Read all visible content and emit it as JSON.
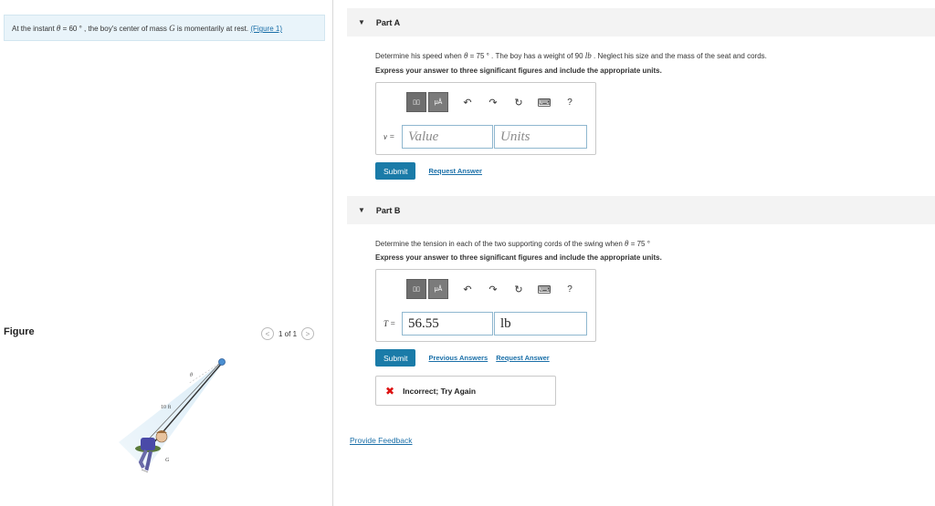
{
  "left": {
    "intro": {
      "pre": "At the instant ",
      "theta": "θ",
      "eq": " = 60 °",
      "mid": " , the boy's center of mass ",
      "g": "G",
      "post": " is momentarily at rest. ",
      "link": "(Figure 1)"
    },
    "figure_label": "Figure",
    "pager": {
      "prev": "<",
      "text": "1 of 1",
      "next": ">"
    },
    "figure": {
      "length_label": "10 ft",
      "theta_label": "θ",
      "g_label": "G"
    }
  },
  "part_a": {
    "title": "Part A",
    "prompt": {
      "pre": "Determine his speed when ",
      "theta": "θ",
      "eq": " = 75 °",
      "mid": " . The boy has a weight of 90 ",
      "unit": "lb",
      "post": " . Neglect his size and the mass of the seat and cords."
    },
    "instruction": "Express your answer to three significant figures and include the appropriate units.",
    "variable": "v =",
    "value_placeholder": "Value",
    "units_placeholder": "Units",
    "value": "",
    "units": "",
    "submit": "Submit",
    "request": "Request Answer"
  },
  "part_b": {
    "title": "Part B",
    "prompt": {
      "pre": "Determine the tension in each of the two supporting cords of the swing when ",
      "theta": "θ",
      "eq": " = 75 °"
    },
    "instruction": "Express your answer to three significant figures and include the appropriate units.",
    "variable": "T =",
    "value": "56.55",
    "units": "lb",
    "submit": "Submit",
    "previous": "Previous Answers",
    "request": "Request Answer",
    "feedback": "Incorrect; Try Again"
  },
  "toolbar": {
    "template_icon": "▯▯",
    "mu_label": "μÅ",
    "undo": "↶",
    "redo": "↷",
    "reset": "↻",
    "keyboard": "⌨",
    "help": "?"
  },
  "feedback_icon": "✖",
  "provide_feedback": "Provide Feedback",
  "colors": {
    "accent": "#1a7ba8",
    "error": "#dd1111",
    "intro_bg": "#e9f4fa"
  }
}
